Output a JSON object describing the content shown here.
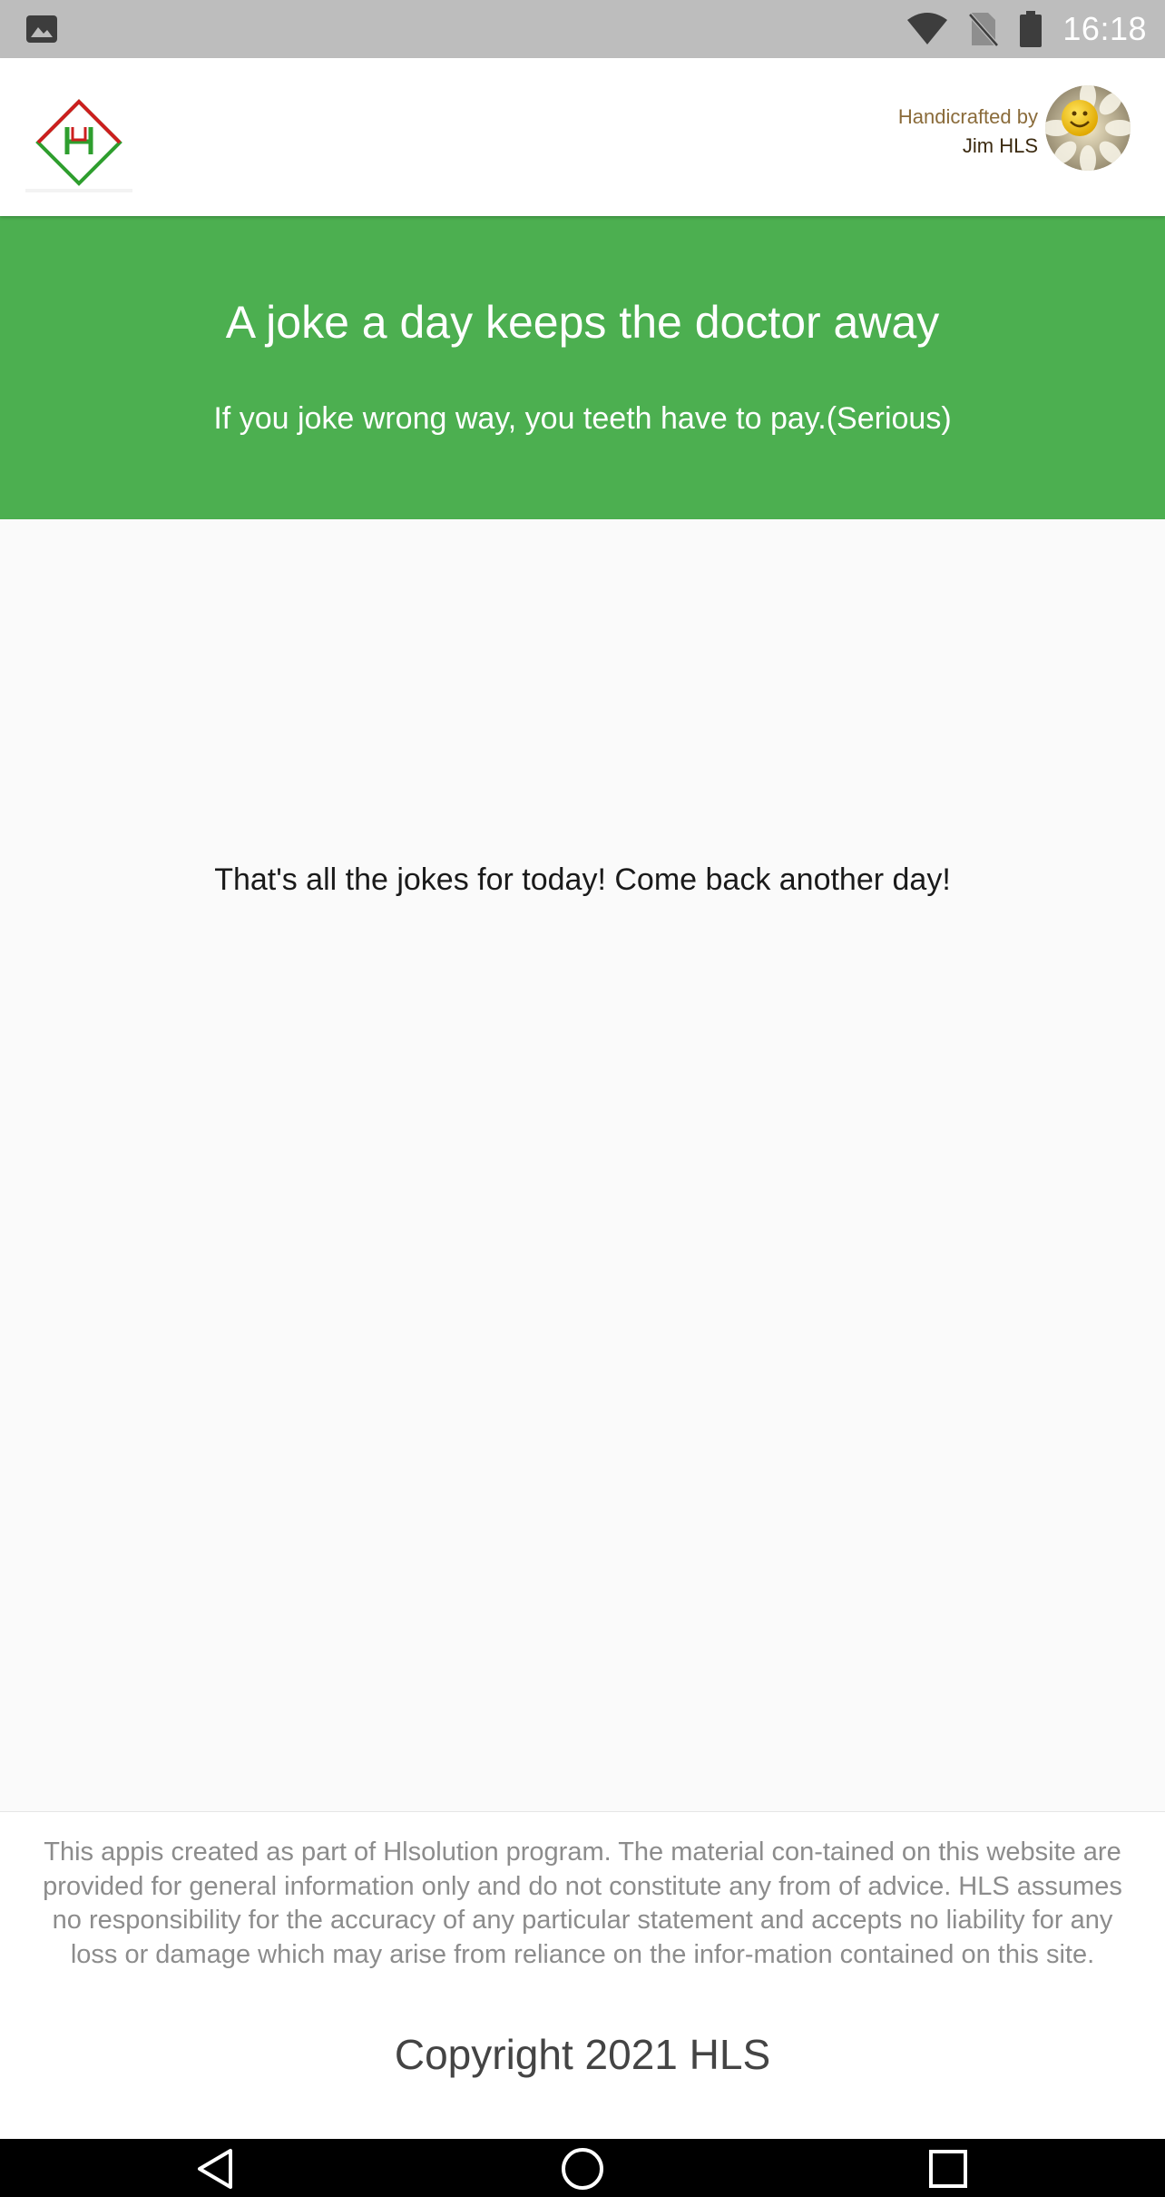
{
  "status_bar": {
    "time": "16:18",
    "icons": [
      "gallery-icon",
      "wifi-icon",
      "no-sim-icon",
      "battery-icon"
    ],
    "color": "#bdbdbd"
  },
  "header": {
    "logo_icon": "hls-logo-icon",
    "credit_line1": "Handicrafted by",
    "credit_line2": "Jim HLS",
    "avatar_icon": "smiley-flower-avatar"
  },
  "hero": {
    "title": "A joke a day keeps the doctor away",
    "subtitle": "If you joke wrong way, you teeth have to pay.(Serious)",
    "background": "#4caf50"
  },
  "main": {
    "message": "That's all the jokes for today! Come back another day!"
  },
  "footer": {
    "disclaimer": "This appis created as part of Hlsolution program. The material con-tained on this website are provided for general information only and do not constitute any from of advice. HLS assumes no responsibility for the accuracy of any particular statement and accepts no liability for any loss or damage which may arise from reliance on the infor-mation contained on this site.",
    "copyright": "Copyright 2021 HLS"
  },
  "nav_bar": {
    "icons": [
      "back-icon",
      "home-icon",
      "recents-icon"
    ]
  }
}
